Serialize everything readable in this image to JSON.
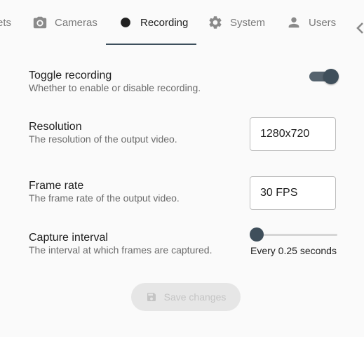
{
  "tabs": [
    {
      "label": "ets",
      "icon": "presets-icon",
      "active": false
    },
    {
      "label": "Cameras",
      "icon": "camera-icon",
      "active": false
    },
    {
      "label": "Recording",
      "icon": "record-dot-icon",
      "active": true
    },
    {
      "label": "System",
      "icon": "gear-icon",
      "active": false
    },
    {
      "label": "Users",
      "icon": "person-icon",
      "active": false
    }
  ],
  "settings": {
    "toggle_recording": {
      "title": "Toggle recording",
      "description": "Whether to enable or disable recording.",
      "enabled": true
    },
    "resolution": {
      "title": "Resolution",
      "description": "The resolution of the output video.",
      "value": "1280x720"
    },
    "frame_rate": {
      "title": "Frame rate",
      "description": "The frame rate of the output video.",
      "value": "30 FPS"
    },
    "capture_interval": {
      "title": "Capture interval",
      "description": "The interval at which frames are captured.",
      "value_label": "Every 0.25 seconds",
      "slider_fraction": 0
    }
  },
  "actions": {
    "save_label": "Save changes",
    "save_disabled": true
  },
  "colors": {
    "accent": "#3f4f5b",
    "text": "#212121",
    "muted": "#6b6b6b"
  }
}
